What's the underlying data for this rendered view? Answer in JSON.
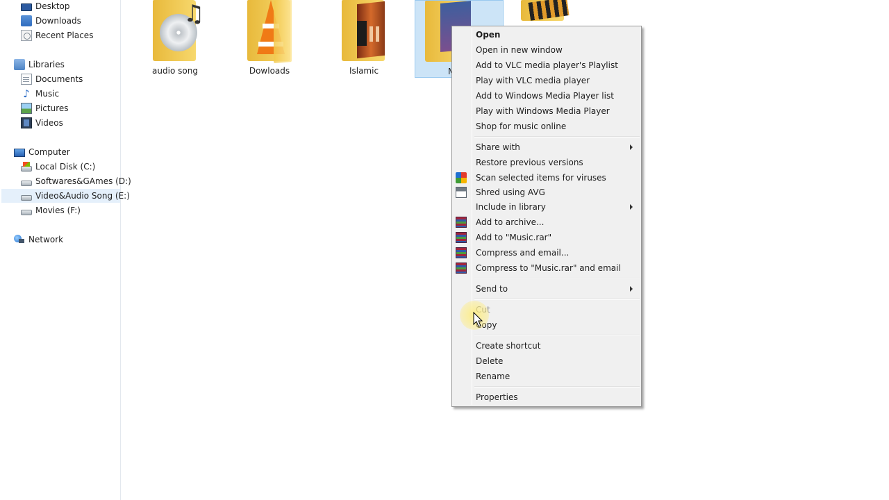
{
  "nav": {
    "favorites": [
      "Desktop",
      "Downloads",
      "Recent Places"
    ],
    "libraries": {
      "label": "Libraries",
      "items": [
        "Documents",
        "Music",
        "Pictures",
        "Videos"
      ]
    },
    "computer": {
      "label": "Computer",
      "drives": [
        "Local Disk (C:)",
        "Softwares&GAmes (D:)",
        "Video&Audio Song (E:)",
        "Movies (F:)"
      ],
      "selected": "Video&Audio Song (E:)"
    },
    "network": "Network"
  },
  "folders": [
    {
      "name": "audio song",
      "icon": "music-cd-folder-icon"
    },
    {
      "name": "Dowloads",
      "icon": "vlc-folder-icon"
    },
    {
      "name": "Islamic",
      "icon": "picture-folder-icon"
    },
    {
      "name": "M",
      "icon": "album-folder-icon",
      "selected": true
    },
    {
      "name": "",
      "icon": "film-folder-icon"
    }
  ],
  "context_menu": {
    "items": [
      {
        "label": "Open",
        "bold": true
      },
      {
        "label": "Open in new window"
      },
      {
        "label": "Add to VLC media player's Playlist"
      },
      {
        "label": "Play with VLC media player"
      },
      {
        "label": "Add to Windows Media Player list"
      },
      {
        "label": "Play with Windows Media Player"
      },
      {
        "label": "Shop for music online"
      },
      {
        "label": "Share with",
        "submenu": true
      },
      {
        "label": "Restore previous versions"
      },
      {
        "label": "Scan selected items for viruses",
        "icon": "avg-icon"
      },
      {
        "label": "Shred using AVG",
        "icon": "shredder-icon"
      },
      {
        "label": "Include in library",
        "submenu": true
      },
      {
        "label": "Add to archive...",
        "icon": "winrar-icon"
      },
      {
        "label": "Add to \"Music.rar\"",
        "icon": "winrar-icon"
      },
      {
        "label": "Compress and email...",
        "icon": "winrar-icon"
      },
      {
        "label": "Compress to \"Music.rar\" and email",
        "icon": "winrar-icon"
      },
      {
        "label": "Send to",
        "submenu": true
      },
      {
        "label": "Cut"
      },
      {
        "label": "Copy"
      },
      {
        "label": "Create shortcut"
      },
      {
        "label": "Delete"
      },
      {
        "label": "Rename"
      },
      {
        "label": "Properties"
      }
    ]
  },
  "colors": {
    "selection": "#cce4f7",
    "menu_bg": "#f0f0f0",
    "nav_selection": "#e5f0fb"
  }
}
